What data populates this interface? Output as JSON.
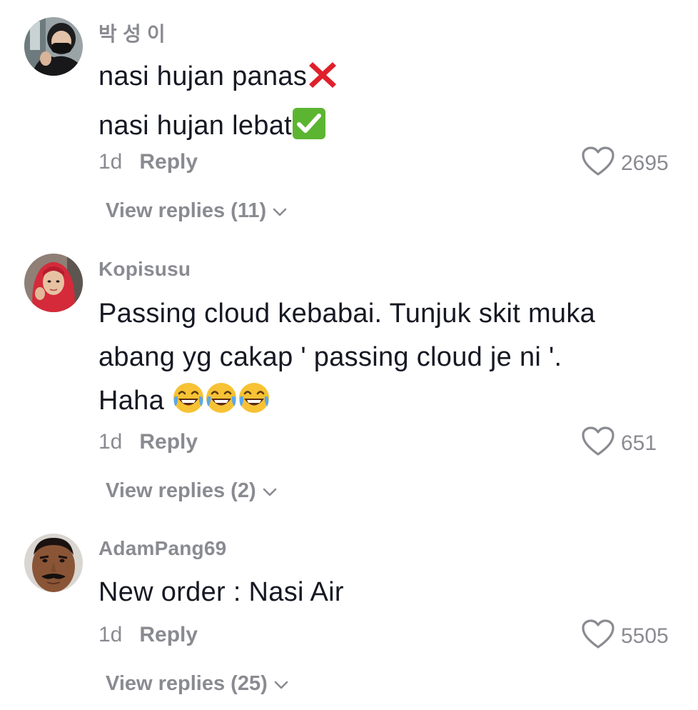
{
  "comments": [
    {
      "username": "박 성 이",
      "lines": [
        "nasi hujan panas",
        "nasi hujan lebat"
      ],
      "line_emojis": [
        "cross-mark-emoji",
        "check-mark-button-emoji"
      ],
      "time": "1d",
      "reply_label": "Reply",
      "likes": "2695",
      "view_replies": "View replies (11)"
    },
    {
      "username": "Kopisusu",
      "lines": [
        "Passing cloud kebabai. Tunjuk skit muka",
        "abang yg cakap ' passing cloud je ni '.",
        "Haha "
      ],
      "line_emojis": [
        "face-with-tears-of-joy-emoji x3"
      ],
      "time": "1d",
      "reply_label": "Reply",
      "likes": "651",
      "view_replies": "View replies (2)"
    },
    {
      "username": "AdamPang69",
      "lines": [
        "New order : Nasi Air"
      ],
      "time": "1d",
      "reply_label": "Reply",
      "likes": "5505",
      "view_replies": "View replies (25)"
    }
  ],
  "icons": {
    "like": "heart-outline-icon",
    "expand": "chevron-down-icon"
  },
  "colors": {
    "text": "#161823",
    "muted": "#8a8b91",
    "cross": "#e0202a",
    "check_bg": "#5cb531"
  }
}
